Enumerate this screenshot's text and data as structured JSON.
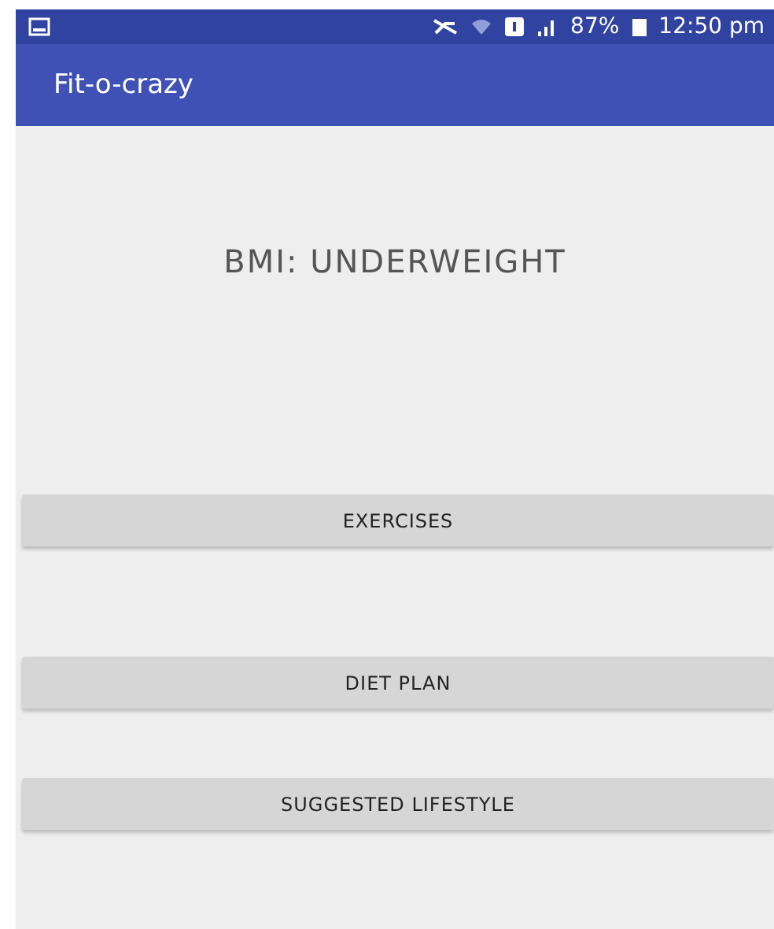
{
  "status_bar": {
    "battery": "87%",
    "time": "12:50 pm"
  },
  "app_bar": {
    "title": "Fit-o-crazy"
  },
  "result": {
    "text": "BMI: UNDERWEIGHT"
  },
  "buttons": [
    "EXERCISES",
    "DIET PLAN",
    "SUGGESTED LIFESTYLE"
  ]
}
